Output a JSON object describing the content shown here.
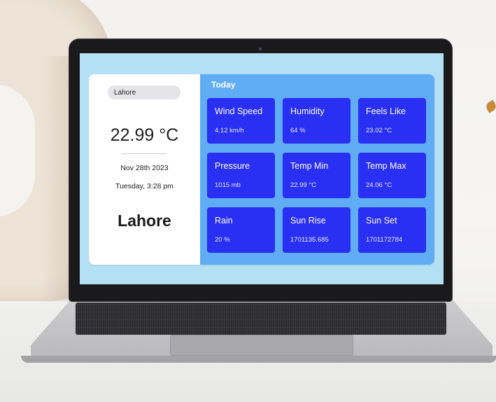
{
  "search": {
    "value": "Lahore"
  },
  "current": {
    "temperature": "22.99 °C",
    "date": "Nov 28th 2023",
    "day_time": "Tuesday, 3:28 pm",
    "city": "Lahore"
  },
  "today": {
    "heading": "Today",
    "cards": [
      {
        "title": "Wind Speed",
        "value": "4.12 km/h"
      },
      {
        "title": "Humidity",
        "value": "64 %"
      },
      {
        "title": "Feels Like",
        "value": "23.02 °C"
      },
      {
        "title": "Pressure",
        "value": "1015 mb"
      },
      {
        "title": "Temp Min",
        "value": "22.99 °C"
      },
      {
        "title": "Temp Max",
        "value": "24.06 °C"
      },
      {
        "title": "Rain",
        "value": "20 %"
      },
      {
        "title": "Sun Rise",
        "value": "1701135.685"
      },
      {
        "title": "Sun Set",
        "value": "1701172784"
      }
    ]
  },
  "colors": {
    "screen_background": "#b3e0f5",
    "left_panel": "#ffffff",
    "right_panel": "#60adf5",
    "card": "#2a2ff4"
  }
}
